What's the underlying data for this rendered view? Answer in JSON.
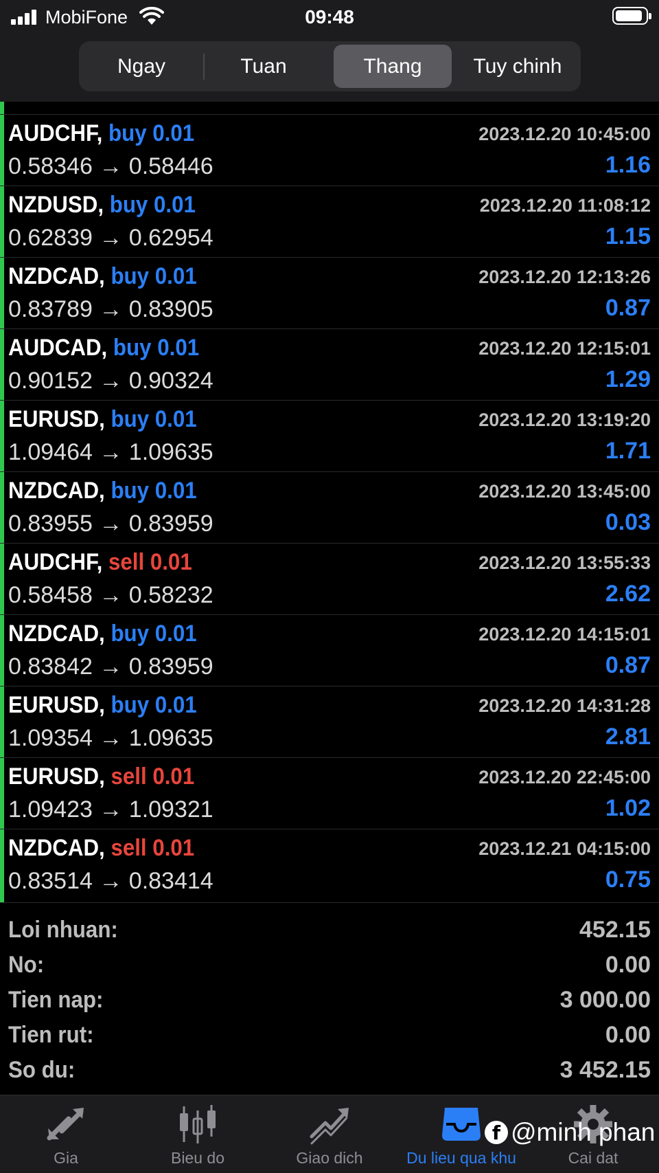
{
  "status_bar": {
    "carrier": "MobiFone",
    "time": "09:48"
  },
  "period_tabs": [
    {
      "label": "Ngay",
      "active": false
    },
    {
      "label": "Tuan",
      "active": false
    },
    {
      "label": "Thang",
      "active": true
    },
    {
      "label": "Tuy chinh",
      "active": false
    }
  ],
  "trades": [
    {
      "symbol": "AUDCHF,",
      "side": "buy 0.01",
      "type": "buy",
      "date": "2023.12.20 10:45:00",
      "prices": "0.58346 → 0.58446",
      "profit": "1.16"
    },
    {
      "symbol": "NZDUSD,",
      "side": "buy 0.01",
      "type": "buy",
      "date": "2023.12.20 11:08:12",
      "prices": "0.62839 → 0.62954",
      "profit": "1.15"
    },
    {
      "symbol": "NZDCAD,",
      "side": "buy 0.01",
      "type": "buy",
      "date": "2023.12.20 12:13:26",
      "prices": "0.83789 → 0.83905",
      "profit": "0.87"
    },
    {
      "symbol": "AUDCAD,",
      "side": "buy 0.01",
      "type": "buy",
      "date": "2023.12.20 12:15:01",
      "prices": "0.90152 → 0.90324",
      "profit": "1.29"
    },
    {
      "symbol": "EURUSD,",
      "side": "buy 0.01",
      "type": "buy",
      "date": "2023.12.20 13:19:20",
      "prices": "1.09464 → 1.09635",
      "profit": "1.71"
    },
    {
      "symbol": "NZDCAD,",
      "side": "buy 0.01",
      "type": "buy",
      "date": "2023.12.20 13:45:00",
      "prices": "0.83955 → 0.83959",
      "profit": "0.03"
    },
    {
      "symbol": "AUDCHF,",
      "side": "sell 0.01",
      "type": "sell",
      "date": "2023.12.20 13:55:33",
      "prices": "0.58458 → 0.58232",
      "profit": "2.62"
    },
    {
      "symbol": "NZDCAD,",
      "side": "buy 0.01",
      "type": "buy",
      "date": "2023.12.20 14:15:01",
      "prices": "0.83842 → 0.83959",
      "profit": "0.87"
    },
    {
      "symbol": "EURUSD,",
      "side": "buy 0.01",
      "type": "buy",
      "date": "2023.12.20 14:31:28",
      "prices": "1.09354 → 1.09635",
      "profit": "2.81"
    },
    {
      "symbol": "EURUSD,",
      "side": "sell 0.01",
      "type": "sell",
      "date": "2023.12.20 22:45:00",
      "prices": "1.09423 → 1.09321",
      "profit": "1.02"
    },
    {
      "symbol": "NZDCAD,",
      "side": "sell 0.01",
      "type": "sell",
      "date": "2023.12.21 04:15:00",
      "prices": "0.83514 → 0.83414",
      "profit": "0.75"
    }
  ],
  "summary": [
    {
      "label": "Loi nhuan:",
      "value": "452.15"
    },
    {
      "label": "No:",
      "value": "0.00"
    },
    {
      "label": "Tien nap:",
      "value": "3 000.00"
    },
    {
      "label": "Tien rut:",
      "value": "0.00"
    },
    {
      "label": "So du:",
      "value": "3 452.15"
    }
  ],
  "tabbar": [
    {
      "label": "Gia",
      "icon": "quotes-arrows-icon",
      "active": false
    },
    {
      "label": "Bieu do",
      "icon": "candlestick-chart-icon",
      "active": false
    },
    {
      "label": "Giao dich",
      "icon": "trade-chart-icon",
      "active": false
    },
    {
      "label": "Du lieu qua khu",
      "icon": "history-tray-icon",
      "active": true
    },
    {
      "label": "Cai dat",
      "icon": "gear-icon",
      "active": false
    }
  ],
  "watermark": {
    "text": "@minh phan",
    "icon": "facebook-icon"
  },
  "colors": {
    "buy": "#2b7ff6",
    "sell": "#e8453c",
    "profit": "#2b7ff6",
    "accent_bar": "#2ec84f"
  }
}
